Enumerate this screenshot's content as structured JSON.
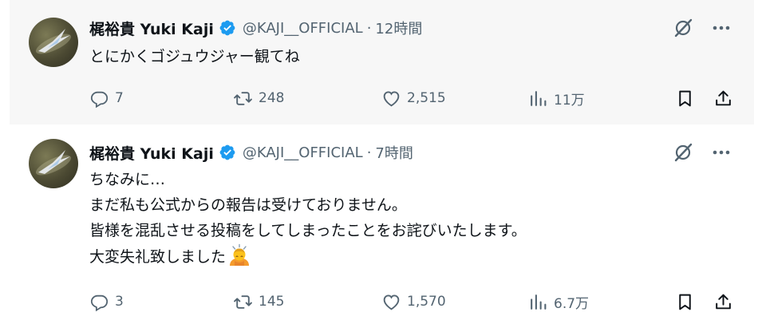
{
  "tweets": [
    {
      "author_name": "梶裕貴 Yuki Kaji",
      "handle": "@KAJI__OFFICIAL",
      "separator": "·",
      "time": "12時間",
      "lines": [
        "とにかくゴジュウジャー観てね"
      ],
      "stats": {
        "replies": "7",
        "retweets": "248",
        "likes": "2,515",
        "views": "11万"
      }
    },
    {
      "author_name": "梶裕貴 Yuki Kaji",
      "handle": "@KAJI__OFFICIAL",
      "separator": "·",
      "time": "7時間",
      "lines": [
        "ちなみに…",
        "まだ私も公式からの報告は受けておりません。",
        "皆様を混乱させる投稿をしてしまったことをお詫びいたします。",
        "大変失礼致しました"
      ],
      "emoji": "bowing-person-emoji",
      "stats": {
        "replies": "3",
        "retweets": "145",
        "likes": "1,570",
        "views": "6.7万"
      }
    }
  ],
  "colors": {
    "verified": "#1d9bf0",
    "secondary_text": "#536471",
    "primary_text": "#0f1419",
    "highlight_bg": "#f7f7f7"
  },
  "icons": [
    "verified-badge-icon",
    "grok-icon",
    "more-icon",
    "reply-icon",
    "retweet-icon",
    "like-icon",
    "views-icon",
    "bookmark-icon",
    "share-icon"
  ]
}
